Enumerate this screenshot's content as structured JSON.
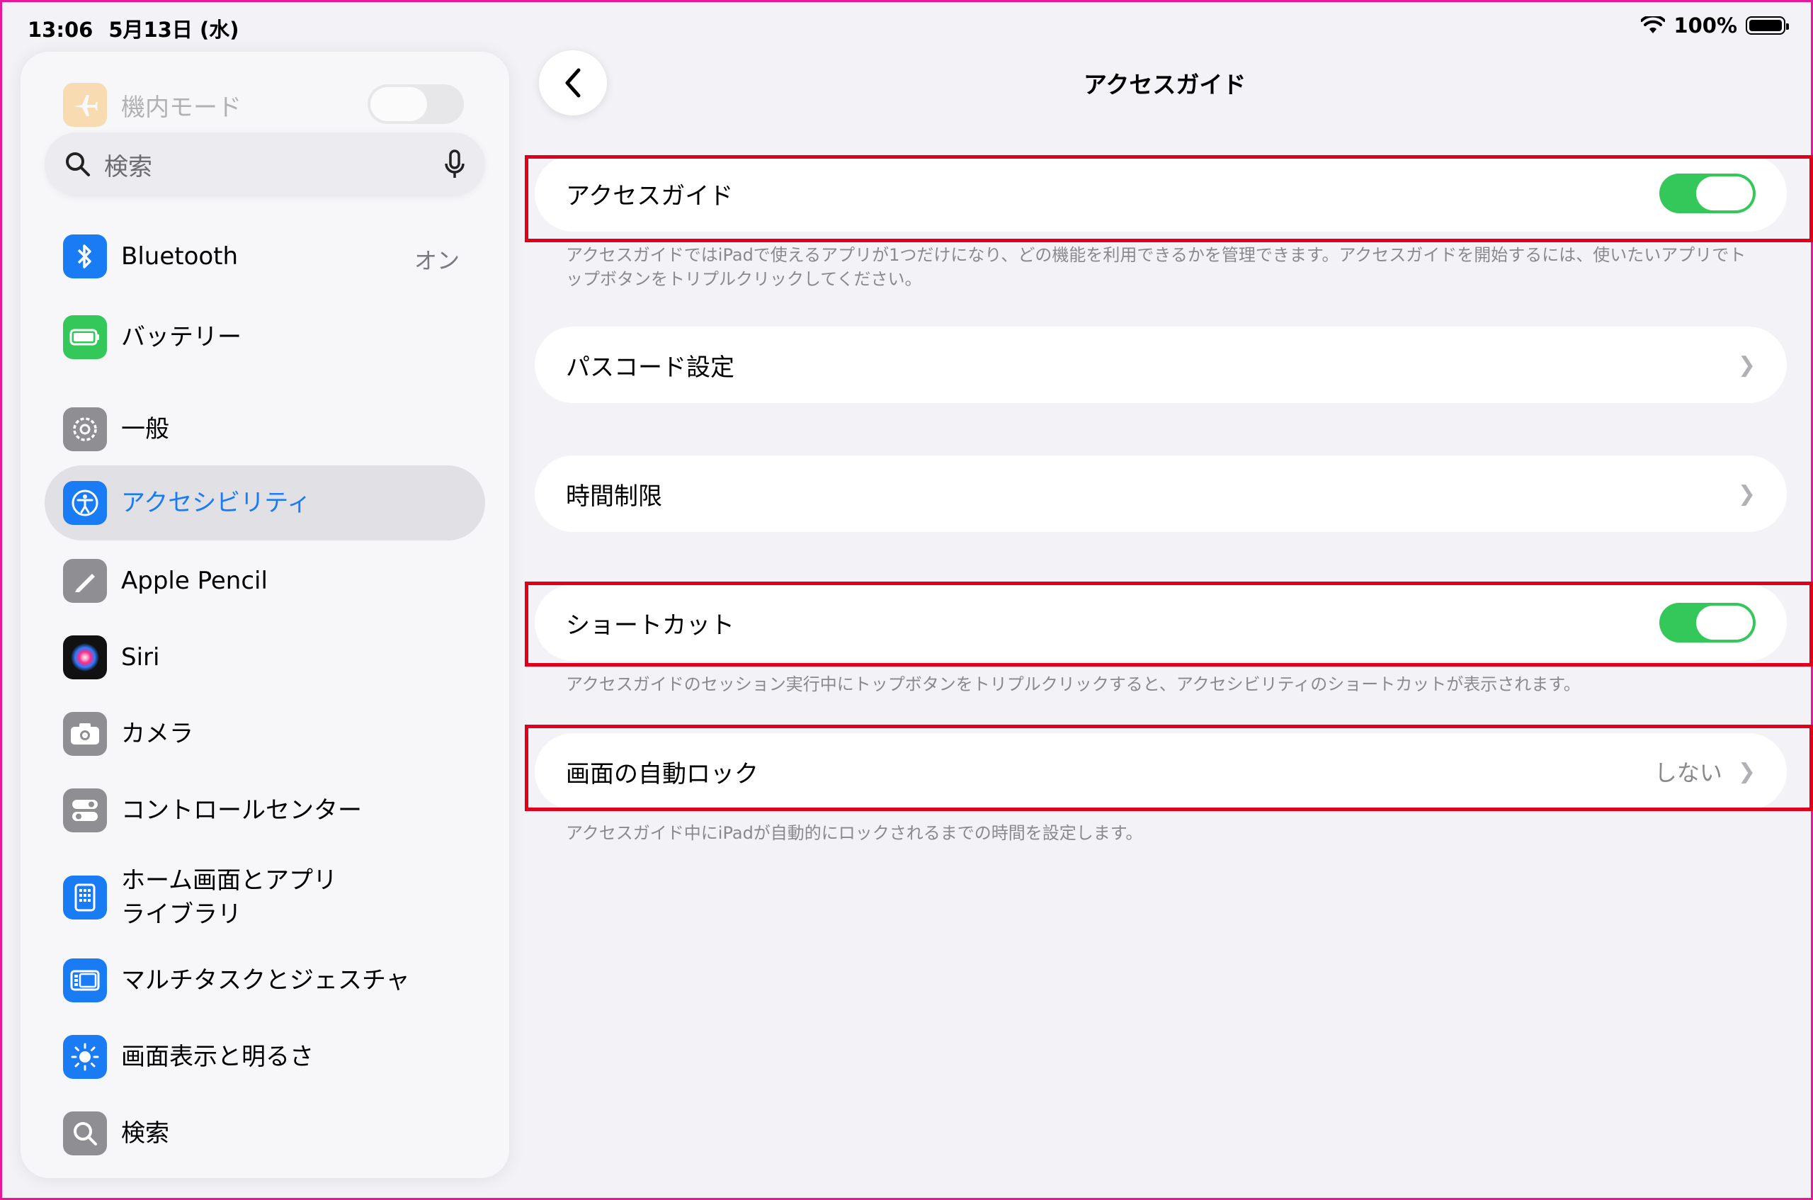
{
  "status": {
    "time": "13:06",
    "date": "5月13日 (水)",
    "battery": "100%"
  },
  "sidebar": {
    "airplane_label": "機内モード",
    "search_placeholder": "検索",
    "items": [
      {
        "label": "Bluetooth",
        "value": "オン",
        "icon": "bluetooth-icon",
        "color": "#1a7cf5"
      },
      {
        "label": "バッテリー",
        "icon": "battery-icon",
        "color": "#34c759"
      },
      {
        "label": "一般",
        "icon": "gear-icon",
        "color": "#8e8e93"
      },
      {
        "label": "アクセシビリティ",
        "icon": "accessibility-icon",
        "color": "#1a7cf5",
        "selected": true
      },
      {
        "label": "Apple Pencil",
        "icon": "pencil-icon",
        "color": "#8e8e93"
      },
      {
        "label": "Siri",
        "icon": "siri-icon",
        "color": "#222"
      },
      {
        "label": "カメラ",
        "icon": "camera-icon",
        "color": "#8e8e93"
      },
      {
        "label": "コントロールセンター",
        "icon": "control-center-icon",
        "color": "#8e8e93"
      },
      {
        "label_line1": "ホーム画面とアプリ",
        "label_line2": "ライブラリ",
        "icon": "home-screen-icon",
        "color": "#1a7cf5"
      },
      {
        "label": "マルチタスクとジェスチャ",
        "icon": "multitask-icon",
        "color": "#1a7cf5"
      },
      {
        "label": "画面表示と明るさ",
        "icon": "brightness-icon",
        "color": "#1a7cf5"
      },
      {
        "label": "検索",
        "icon": "search-icon",
        "color": "#8e8e93"
      }
    ]
  },
  "main": {
    "title": "アクセスガイド",
    "guided_access": {
      "label": "アクセスガイド",
      "on": true
    },
    "guided_access_footer": "アクセスガイドではiPadで使えるアプリが1つだけになり、どの機能を利用できるかを管理できます。アクセスガイドを開始するには、使いたいアプリでトップボタンをトリプルクリックしてください。",
    "passcode": {
      "label": "パスコード設定"
    },
    "time_limit": {
      "label": "時間制限"
    },
    "shortcut": {
      "label": "ショートカット",
      "on": true
    },
    "shortcut_footer": "アクセスガイドのセッション実行中にトップボタンをトリプルクリックすると、アクセシビリティのショートカットが表示されます。",
    "auto_lock": {
      "label": "画面の自動ロック",
      "value": "しない"
    },
    "auto_lock_footer": "アクセスガイド中にiPadが自動的にロックされるまでの時間を設定します。"
  },
  "colors": {
    "accent": "#1a7cf5",
    "toggle_on": "#34c759",
    "highlight": "#e0001b"
  }
}
